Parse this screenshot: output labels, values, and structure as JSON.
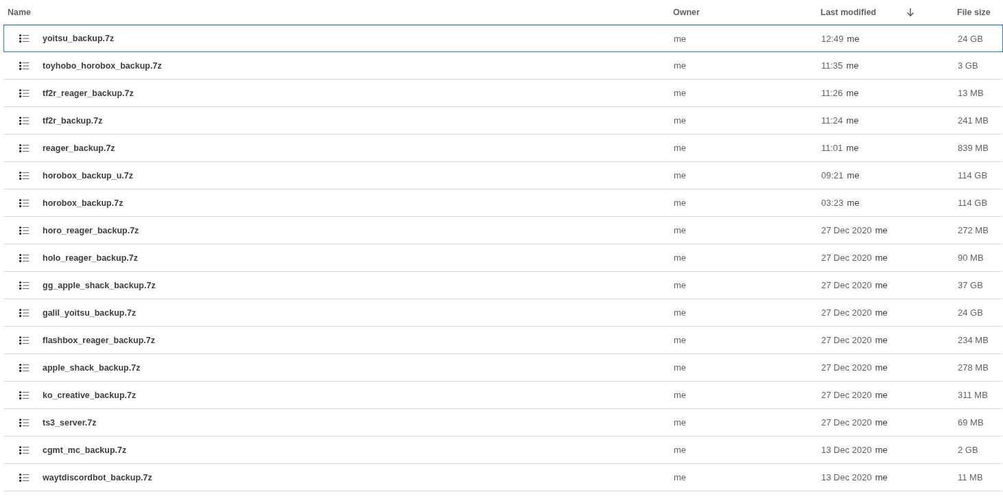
{
  "columns": [
    {
      "label": "Name",
      "sorted": false
    },
    {
      "label": "Owner",
      "sorted": false
    },
    {
      "label": "Last modified",
      "sorted": true
    },
    {
      "label": "File size",
      "sorted": false
    }
  ],
  "rows": [
    {
      "name": "yoitsu_backup.7z",
      "owner": "me",
      "modified": "12:49",
      "modified_by": "me",
      "size": "24 GB",
      "selected": true
    },
    {
      "name": "toyhobo_horobox_backup.7z",
      "owner": "me",
      "modified": "11:35",
      "modified_by": "me",
      "size": "3 GB",
      "selected": false
    },
    {
      "name": "tf2r_reager_backup.7z",
      "owner": "me",
      "modified": "11:26",
      "modified_by": "me",
      "size": "13 MB",
      "selected": false
    },
    {
      "name": "tf2r_backup.7z",
      "owner": "me",
      "modified": "11:24",
      "modified_by": "me",
      "size": "241 MB",
      "selected": false
    },
    {
      "name": "reager_backup.7z",
      "owner": "me",
      "modified": "11:01",
      "modified_by": "me",
      "size": "839 MB",
      "selected": false
    },
    {
      "name": "horobox_backup_u.7z",
      "owner": "me",
      "modified": "09:21",
      "modified_by": "me",
      "size": "114 GB",
      "selected": false
    },
    {
      "name": "horobox_backup.7z",
      "owner": "me",
      "modified": "03:23",
      "modified_by": "me",
      "size": "114 GB",
      "selected": false
    },
    {
      "name": "horo_reager_backup.7z",
      "owner": "me",
      "modified": "27 Dec 2020",
      "modified_by": "me",
      "size": "272 MB",
      "selected": false
    },
    {
      "name": "holo_reager_backup.7z",
      "owner": "me",
      "modified": "27 Dec 2020",
      "modified_by": "me",
      "size": "90 MB",
      "selected": false
    },
    {
      "name": "gg_apple_shack_backup.7z",
      "owner": "me",
      "modified": "27 Dec 2020",
      "modified_by": "me",
      "size": "37 GB",
      "selected": false
    },
    {
      "name": "galil_yoitsu_backup.7z",
      "owner": "me",
      "modified": "27 Dec 2020",
      "modified_by": "me",
      "size": "24 GB",
      "selected": false
    },
    {
      "name": "flashbox_reager_backup.7z",
      "owner": "me",
      "modified": "27 Dec 2020",
      "modified_by": "me",
      "size": "234 MB",
      "selected": false
    },
    {
      "name": "apple_shack_backup.7z",
      "owner": "me",
      "modified": "27 Dec 2020",
      "modified_by": "me",
      "size": "278 MB",
      "selected": false
    },
    {
      "name": "ko_creative_backup.7z",
      "owner": "me",
      "modified": "27 Dec 2020",
      "modified_by": "me",
      "size": "311 MB",
      "selected": false
    },
    {
      "name": "ts3_server.7z",
      "owner": "me",
      "modified": "27 Dec 2020",
      "modified_by": "me",
      "size": "69 MB",
      "selected": false
    },
    {
      "name": "cgmt_mc_backup.7z",
      "owner": "me",
      "modified": "13 Dec 2020",
      "modified_by": "me",
      "size": "2 GB",
      "selected": false
    },
    {
      "name": "waytdiscordbot_backup.7z",
      "owner": "me",
      "modified": "13 Dec 2020",
      "modified_by": "me",
      "size": "11 MB",
      "selected": false
    }
  ]
}
